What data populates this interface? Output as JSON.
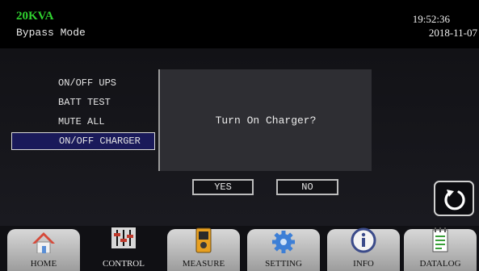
{
  "header": {
    "model": "20KVA",
    "mode": "Bypass Mode",
    "time": "19:52:36",
    "date": "2018-11-07"
  },
  "menu": {
    "items": [
      {
        "label": "ON/OFF UPS"
      },
      {
        "label": "BATT TEST"
      },
      {
        "label": "MUTE ALL"
      },
      {
        "label": "ON/OFF CHARGER",
        "selected": true
      }
    ]
  },
  "dialog": {
    "message": "Turn On Charger?",
    "yes_label": "YES",
    "no_label": "NO"
  },
  "tabs": [
    {
      "label": "HOME",
      "icon": "home-icon"
    },
    {
      "label": "CONTROL",
      "icon": "sliders-icon",
      "active": true
    },
    {
      "label": "MEASURE",
      "icon": "meter-icon"
    },
    {
      "label": "SETTING",
      "icon": "gear-icon"
    },
    {
      "label": "INFO",
      "icon": "info-icon"
    },
    {
      "label": "DATALOG",
      "icon": "log-icon"
    }
  ],
  "colors": {
    "model_text": "#2fd22f",
    "selected_item_bg": "#1a1a5a",
    "dialog_bg": "#2e2e33"
  }
}
